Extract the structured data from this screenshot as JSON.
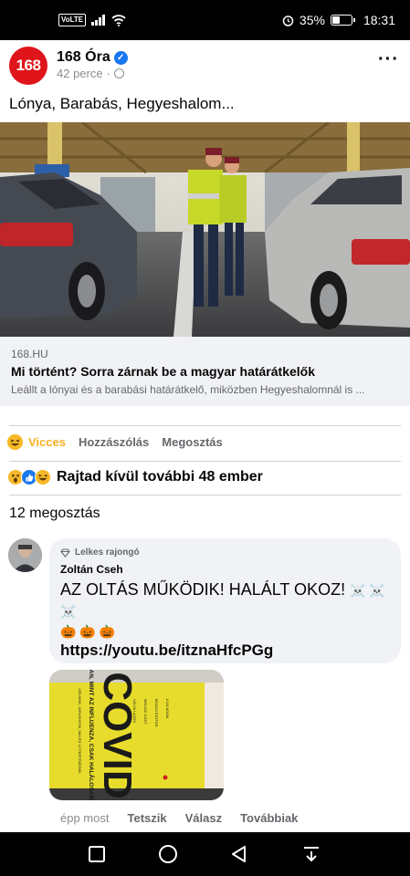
{
  "status_bar": {
    "volte": "VoLTE",
    "battery_text": "35%",
    "battery_level": 0.35,
    "time": "18:31"
  },
  "post": {
    "page_avatar_text": "168",
    "page_name": "168 Óra",
    "time": "42 perce",
    "text": "Lónya, Barabás, Hegyeshalom...",
    "link": {
      "domain": "168.HU",
      "title": "Mi történt? Sorra zárnak be a magyar határátkelők",
      "description": "Leállt a lónyai és a barabási határátkelő, miközben Hegyeshalomnál is ..."
    },
    "actions": {
      "reaction": "Vicces",
      "comment": "Hozzászólás",
      "share": "Megosztás"
    },
    "reactions_text": "Rajtad kívül további 48 ember",
    "shares_text": "12 megosztás"
  },
  "comment": {
    "badge": "Lelkes rajongó",
    "author": "Zoltán Cseh",
    "text": "AZ OLTÁS MŰKÖDIK! HALÁLT OKOZ!",
    "skulls": "☠️ ☠️ ☠️",
    "pumpkins": "🎃 🎃 🎃",
    "link": "https://youtu.be/itznaHfcPGg",
    "time": "épp most",
    "like": "Tetszik",
    "reply": "Válasz",
    "more": "Továbbiak",
    "image_book": {
      "title": "COVID",
      "subtitle": "\"OLYAN, MINT AZ INFLUENZA, CSAK HALÁLOSABB\"",
      "side_text": "VÍRUSOK, JÁRVÁNYOK, MAI ÉS ÚJ FERTŐZÉSEK",
      "authors": [
        "KUN ÁDÁM",
        "BOZAN ESZTER",
        "MIKUSZ JUDIT",
        "VÁLYA LAJOS"
      ]
    }
  }
}
